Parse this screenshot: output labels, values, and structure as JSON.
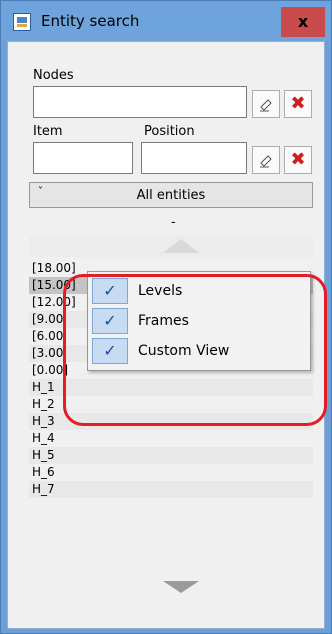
{
  "window": {
    "title": "Entity search",
    "close_label": "x"
  },
  "nodes": {
    "label": "Nodes",
    "value": ""
  },
  "item": {
    "label": "Item",
    "value": ""
  },
  "position": {
    "label": "Position",
    "value": ""
  },
  "filter": {
    "label": "All entities",
    "chevron": "˅"
  },
  "separator_text": "-",
  "entities": [
    {
      "label": "[18.00]",
      "selected": false
    },
    {
      "label": "[15.00]",
      "selected": true
    },
    {
      "label": "[12.00]",
      "selected": false
    },
    {
      "label": "[9.00",
      "selected": false
    },
    {
      "label": "[6.00",
      "selected": false
    },
    {
      "label": "[3.00",
      "selected": false
    },
    {
      "label": "[0.00]",
      "selected": false
    },
    {
      "label": "H_1",
      "selected": false
    },
    {
      "label": "H_2",
      "selected": false
    },
    {
      "label": "H_3",
      "selected": false
    },
    {
      "label": "H_4",
      "selected": false
    },
    {
      "label": "H_5",
      "selected": false
    },
    {
      "label": "H_6",
      "selected": false
    },
    {
      "label": "H_7",
      "selected": false
    }
  ],
  "context_menu": [
    {
      "label": "Levels",
      "checked": true
    },
    {
      "label": "Frames",
      "checked": true
    },
    {
      "label": "Custom View",
      "checked": true
    }
  ],
  "checkmark": "✓",
  "icons": {
    "pick": "eraser-pick-icon",
    "clear": "red-x-icon",
    "app": "entity-search-app-icon",
    "scroll_up": "scroll-up-arrow",
    "scroll_down": "scroll-down-arrow"
  },
  "colors": {
    "highlight": "#e21d25",
    "clear_x": "#cc1f1f",
    "title_bar": "#6ea3db",
    "close_button": "#c94b4b"
  }
}
